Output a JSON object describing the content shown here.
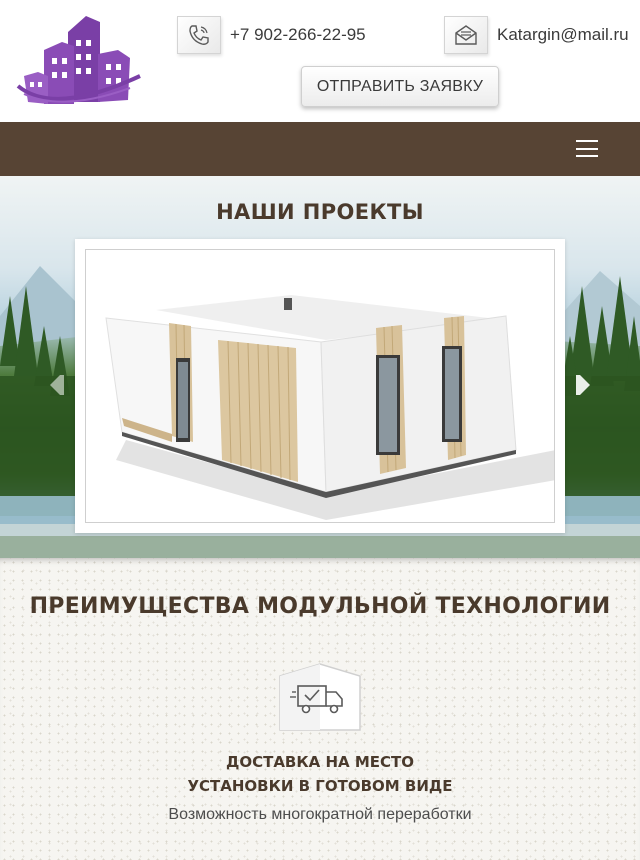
{
  "header": {
    "phone": "+7 902-266-22-95",
    "email": "Katargin@mail.ru",
    "cta_label": "ОТПРАВИТЬ ЗАЯВКУ",
    "logo_icon": "building-logo-icon",
    "phone_icon": "phone-icon",
    "mail_icon": "envelope-icon"
  },
  "nav": {
    "menu_icon": "hamburger-menu-icon",
    "bar_color": "#574434"
  },
  "projects": {
    "title": "НАШИ ПРОЕКТЫ",
    "prev_icon": "arrow-left-icon",
    "next_icon": "arrow-right-icon"
  },
  "advantages": {
    "title": "ПРЕИМУЩЕСТВА МОДУЛЬНОЙ ТЕХНОЛОГИИ",
    "items": [
      {
        "icon": "delivery-truck-icon",
        "heading_line1": "ДОСТАВКА НА МЕСТО",
        "heading_line2": "УСТАНОВКИ В ГОТОВОМ ВИДЕ",
        "description": "Возможность многократной переработки"
      }
    ]
  },
  "colors": {
    "brand_purple": "#7a3fa6",
    "heading_brown": "#4a3a2c"
  }
}
